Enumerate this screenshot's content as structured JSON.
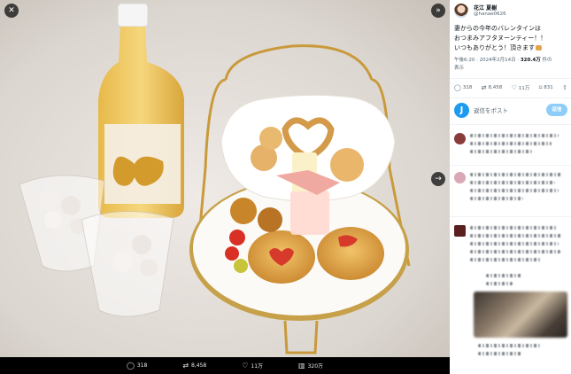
{
  "viewer": {
    "close_icon": "close-icon",
    "expand_icon": "expand-panel-icon",
    "next_icon": "next-arrow-icon",
    "image_alt": "Valentine afternoon tea stand with snacks and a bottle of sake"
  },
  "action_bar": {
    "replies": "318",
    "reposts": "8,458",
    "likes": "11万",
    "views": "320万"
  },
  "author": {
    "name": "花江 夏樹",
    "handle": "@hanae0626"
  },
  "tweet": {
    "lines": [
      "妻からの今年のバレンタインは",
      "おつまみアフタヌーンティー！！",
      "いつもありがとう！頂きます"
    ]
  },
  "meta": {
    "time": "午後6:20",
    "date": "2024年2月14日",
    "views_count": "320.4万",
    "views_suffix": "件の",
    "views_word": "表示"
  },
  "stats": {
    "replies": "318",
    "reposts": "8,458",
    "likes": "11万",
    "bookmarks": "831"
  },
  "reply_box": {
    "avatar_letter": "J",
    "placeholder": "返信をポスト",
    "button": "返信"
  },
  "colors": {
    "accent": "#1d9bf0",
    "reply_button": "#8ecdf8",
    "text_primary": "#0f1419",
    "text_secondary": "#536471"
  }
}
